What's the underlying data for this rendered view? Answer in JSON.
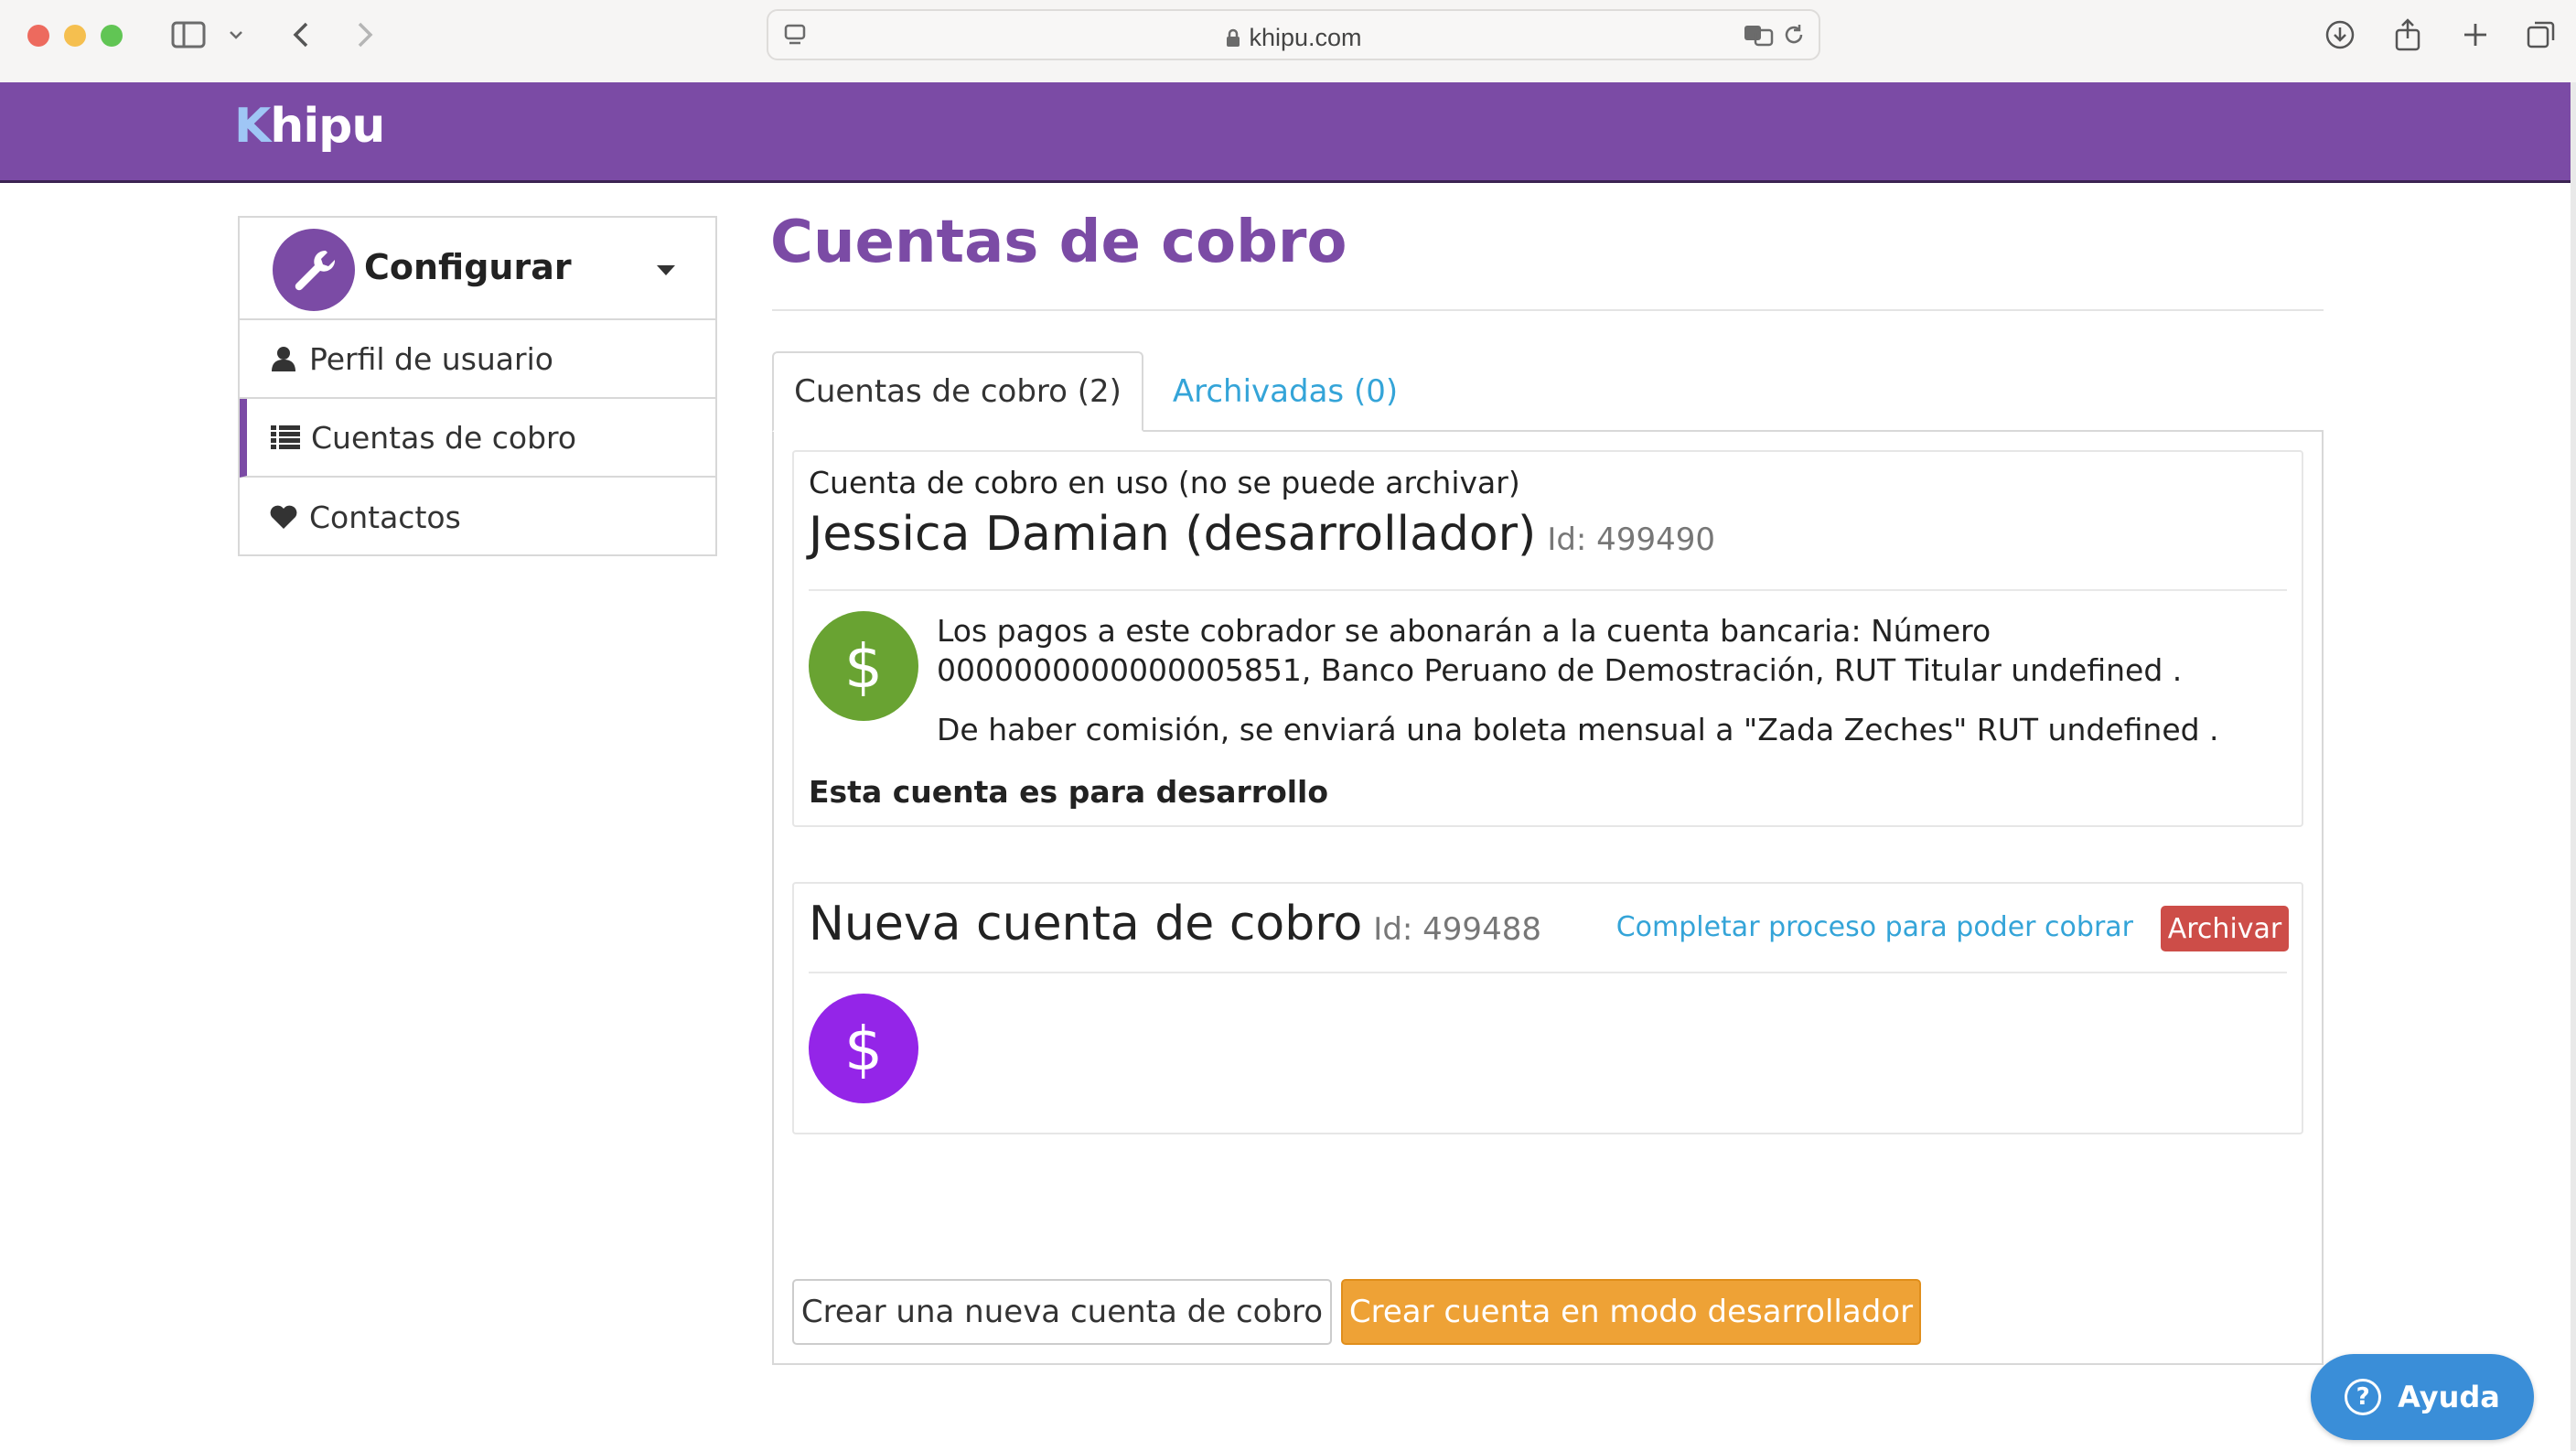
{
  "browser": {
    "url": "khipu.com"
  },
  "header": {
    "logo_k": "K",
    "logo_rest": "hipu"
  },
  "sidebar": {
    "title": "Configurar",
    "items": [
      {
        "label": "Perfil de usuario",
        "icon": "user-icon",
        "active": false
      },
      {
        "label": "Cuentas de cobro",
        "icon": "list-icon",
        "active": true
      },
      {
        "label": "Contactos",
        "icon": "heart-icon",
        "active": false
      }
    ]
  },
  "main": {
    "title": "Cuentas de cobro",
    "tabs": [
      {
        "label": "Cuentas de cobro (2)",
        "active": true
      },
      {
        "label": "Archivadas (0)",
        "active": false
      }
    ],
    "accounts": [
      {
        "note": "Cuenta de cobro en uso (no se puede archivar)",
        "name": "Jessica Damian (desarrollador)",
        "id": "Id: 499490",
        "icon_symbol": "$",
        "icon_color": "#69a332",
        "description_1": "Los pagos a este cobrador se abonarán a la cuenta bancaria: Número 0000000000000005851, Banco Peruano de Demostración, RUT Titular undefined .",
        "description_2": "De haber comisión, se enviará una boleta mensual a \"Zada Zeches\" RUT undefined .",
        "bold_note": "Esta cuenta es para desarrollo"
      },
      {
        "name": "Nueva cuenta de cobro",
        "id": "Id: 499488",
        "link": "Completar proceso para poder cobrar",
        "archive_label": "Archivar",
        "icon_symbol": "$",
        "icon_color": "#9425e8"
      }
    ],
    "buttons": {
      "new_account": "Crear una nueva cuenta de cobro",
      "dev_account": "Crear cuenta en modo desarrollador"
    }
  },
  "help": {
    "icon": "?",
    "label": "Ayuda"
  },
  "colors": {
    "brand": "#7b4ba5",
    "link": "#34a4d8",
    "danger": "#cd4d48",
    "warning": "#eea236"
  }
}
